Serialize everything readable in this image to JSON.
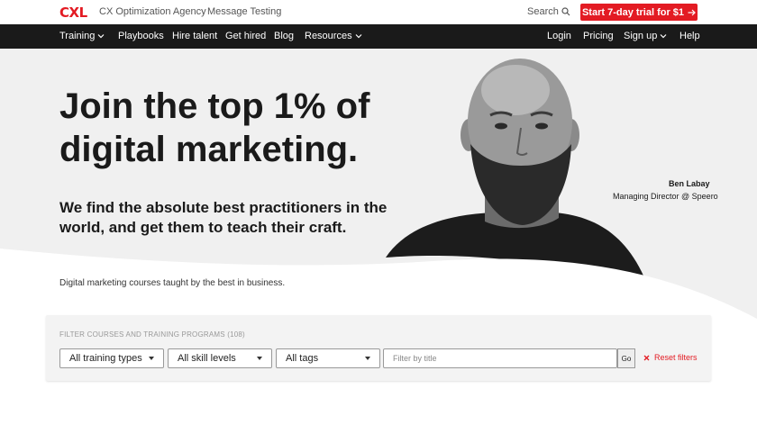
{
  "brand": {
    "logo": "CXL",
    "accent": "#e31b23"
  },
  "topbar": {
    "links": [
      "CX Optimization Agency",
      "Message Testing"
    ],
    "search_label": "Search",
    "cta_label": "Start 7-day trial for $1"
  },
  "nav": {
    "left": [
      {
        "label": "Training",
        "dropdown": true
      },
      {
        "label": "Playbooks",
        "dropdown": false
      },
      {
        "label": "Hire talent",
        "dropdown": false
      },
      {
        "label": "Get hired",
        "dropdown": false
      },
      {
        "label": "Blog",
        "dropdown": false
      },
      {
        "label": "Resources",
        "dropdown": true
      }
    ],
    "right": [
      {
        "label": "Login",
        "dropdown": false
      },
      {
        "label": "Pricing",
        "dropdown": false
      },
      {
        "label": "Sign up",
        "dropdown": true
      },
      {
        "label": "Help",
        "dropdown": false
      }
    ]
  },
  "hero": {
    "headline_line1": "Join the top 1% of",
    "headline_line2": "digital marketing.",
    "subhead": "We find the absolute best practitioners in the world, and get them to teach their craft.",
    "tagline": "Digital marketing courses taught by the best in business.",
    "person_name": "Ben Labay",
    "person_role": "Managing Director @ Speero"
  },
  "filter": {
    "label": "FILTER COURSES AND TRAINING PROGRAMS (108)",
    "type_select": "All training types",
    "skill_select": "All skill levels",
    "tags_select": "All tags",
    "title_placeholder": "Filter by title",
    "go_label": "Go",
    "reset_label": "Reset filters"
  }
}
